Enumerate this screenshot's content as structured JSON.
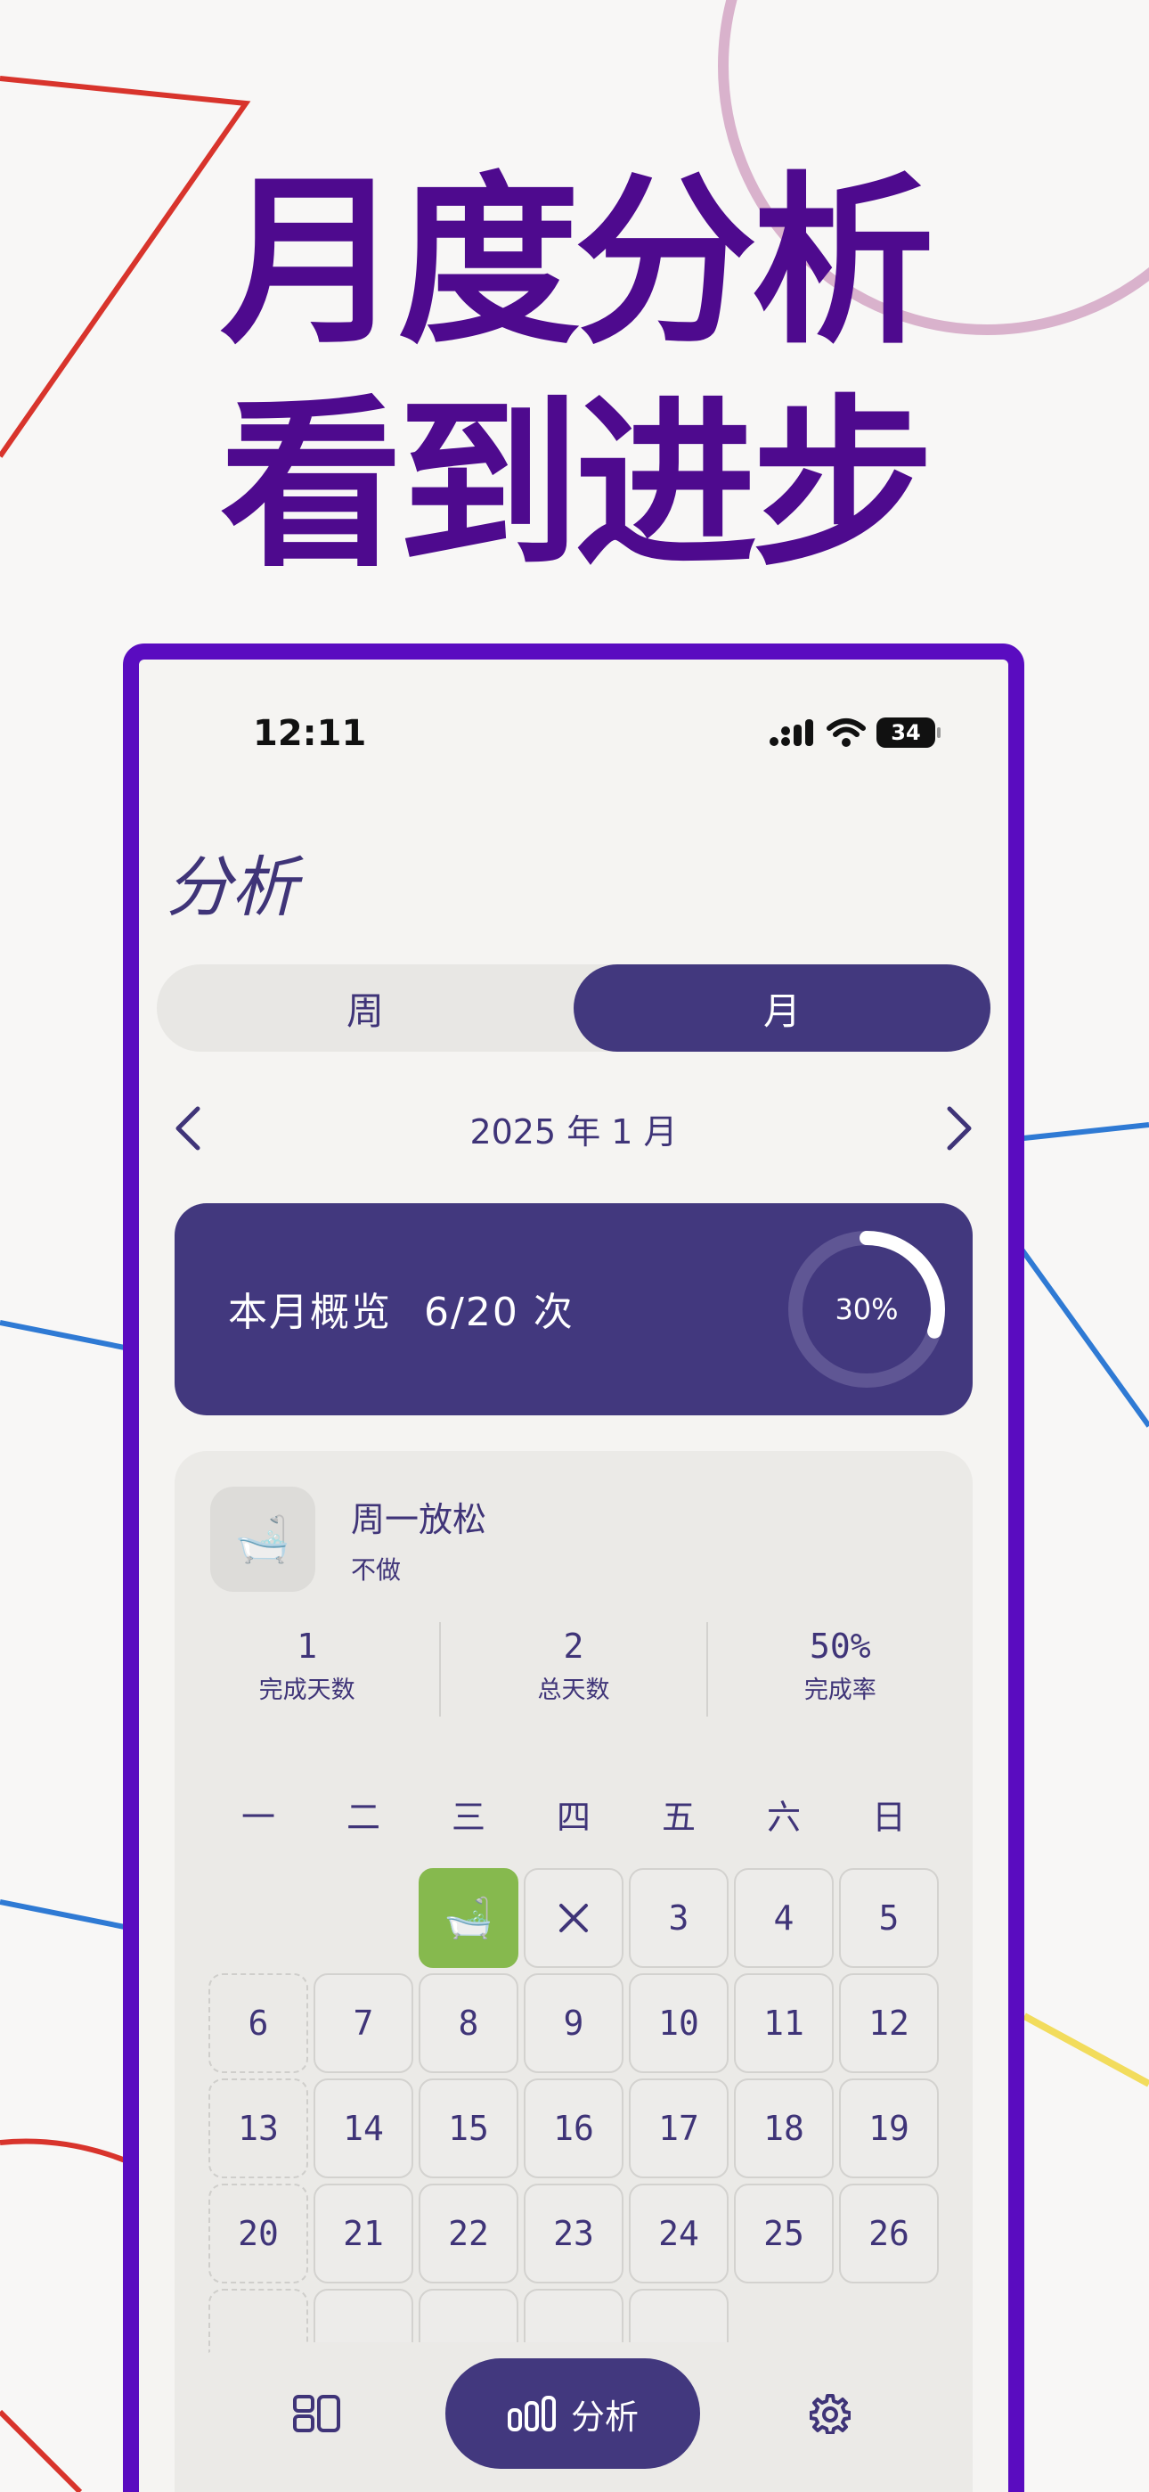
{
  "headline": {
    "line1": "月度分析",
    "line2": "看到进步"
  },
  "status": {
    "time": "12:11",
    "battery": "34"
  },
  "page_title": "分析",
  "segmented": {
    "week": "周",
    "month": "月"
  },
  "month_nav": {
    "label": "2025 年 1 月"
  },
  "overview": {
    "title": "本月概览",
    "count": "6/20 次",
    "percent_label": "30%",
    "progress": 0.3
  },
  "habit": {
    "icon": "bathtub-icon",
    "name": "周一放松",
    "subtitle": "不做",
    "stats": [
      {
        "value": "1",
        "label": "完成天数"
      },
      {
        "value": "2",
        "label": "总天数"
      },
      {
        "value": "50%",
        "label": "完成率"
      }
    ]
  },
  "calendar": {
    "weekdays": [
      "一",
      "二",
      "三",
      "四",
      "五",
      "六",
      "日"
    ],
    "days": [
      "3",
      "4",
      "5",
      "6",
      "7",
      "8",
      "9",
      "10",
      "11",
      "12",
      "13",
      "14",
      "15",
      "16",
      "17",
      "18",
      "19",
      "20",
      "21",
      "22",
      "23",
      "24",
      "25",
      "26"
    ]
  },
  "tabbar": {
    "analysis_label": "分析"
  },
  "colors": {
    "accent": "#42387e",
    "headline": "#4e0a8e",
    "frame": "#5a0cc0",
    "done": "#86b94e"
  }
}
